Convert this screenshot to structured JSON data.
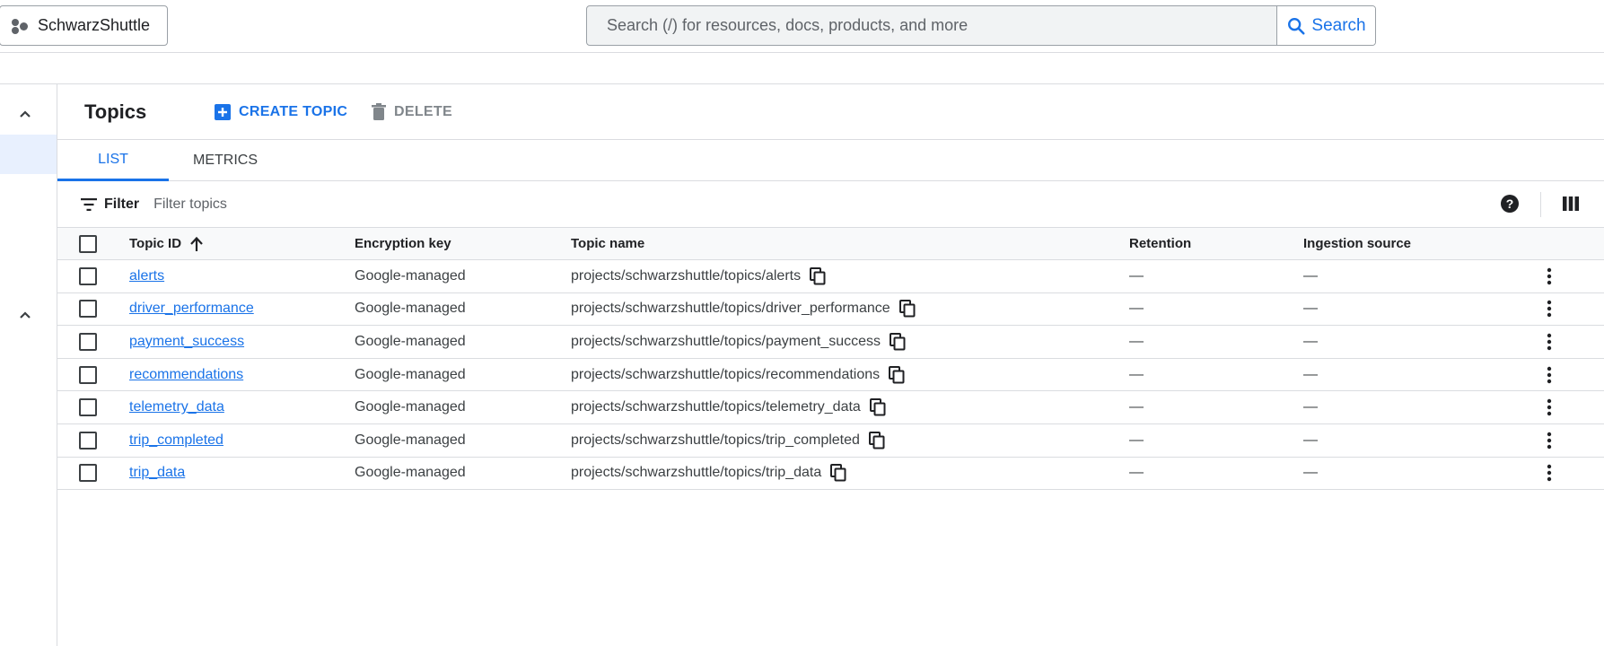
{
  "topbar": {
    "project_name": "SchwarzShuttle",
    "search_placeholder": "Search (/) for resources, docs, products, and more",
    "search_button": "Search"
  },
  "header": {
    "title": "Topics",
    "create_label": "CREATE TOPIC",
    "delete_label": "DELETE"
  },
  "tabs": [
    {
      "label": "LIST",
      "active": true
    },
    {
      "label": "METRICS",
      "active": false
    }
  ],
  "filter": {
    "label": "Filter",
    "placeholder": "Filter topics"
  },
  "table": {
    "columns": [
      "Topic ID",
      "Encryption key",
      "Topic name",
      "Retention",
      "Ingestion source"
    ],
    "sort_column": "Topic ID",
    "sort_direction": "ascending",
    "rows": [
      {
        "id": "alerts",
        "encryption": "Google-managed",
        "name": "projects/schwarzshuttle/topics/alerts",
        "retention": "—",
        "ingestion": "—"
      },
      {
        "id": "driver_performance",
        "encryption": "Google-managed",
        "name": "projects/schwarzshuttle/topics/driver_performance",
        "retention": "—",
        "ingestion": "—"
      },
      {
        "id": "payment_success",
        "encryption": "Google-managed",
        "name": "projects/schwarzshuttle/topics/payment_success",
        "retention": "—",
        "ingestion": "—"
      },
      {
        "id": "recommendations",
        "encryption": "Google-managed",
        "name": "projects/schwarzshuttle/topics/recommendations",
        "retention": "—",
        "ingestion": "—"
      },
      {
        "id": "telemetry_data",
        "encryption": "Google-managed",
        "name": "projects/schwarzshuttle/topics/telemetry_data",
        "retention": "—",
        "ingestion": "—"
      },
      {
        "id": "trip_completed",
        "encryption": "Google-managed",
        "name": "projects/schwarzshuttle/topics/trip_completed",
        "retention": "—",
        "ingestion": "—"
      },
      {
        "id": "trip_data",
        "encryption": "Google-managed",
        "name": "projects/schwarzshuttle/topics/trip_data",
        "retention": "—",
        "ingestion": "—"
      }
    ]
  },
  "icons": {
    "project": "project-dots-icon",
    "search": "search-icon",
    "create": "add-box-icon",
    "delete": "trash-icon",
    "filter": "filter-icon",
    "help": "help-icon",
    "columns": "columns-icon",
    "sort": "arrow-up-icon",
    "copy": "copy-icon",
    "more": "more-vert-icon",
    "collapse": "chevron-up-icon"
  },
  "colors": {
    "accent": "#1a73e8",
    "text": "#202124",
    "muted": "#5f6368",
    "border": "#dadce0",
    "selected_bg": "#e8f0fe"
  }
}
